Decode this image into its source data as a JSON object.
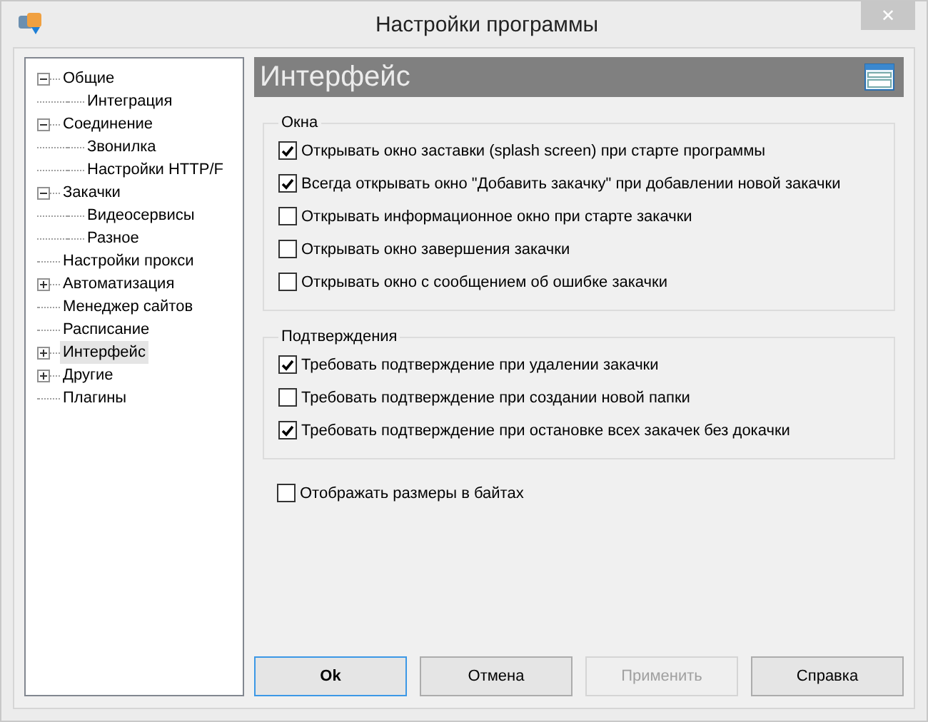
{
  "window": {
    "title": "Настройки программы",
    "close": "✕"
  },
  "tree": [
    {
      "label": "Общие",
      "expanded": true,
      "selected": false,
      "children": [
        {
          "label": "Интеграция",
          "selected": false
        }
      ]
    },
    {
      "label": "Соединение",
      "expanded": true,
      "selected": false,
      "children": [
        {
          "label": "Звонилка",
          "selected": false
        },
        {
          "label": "Настройки HTTP/F",
          "selected": false
        }
      ]
    },
    {
      "label": "Закачки",
      "expanded": true,
      "selected": false,
      "children": [
        {
          "label": "Видеосервисы",
          "selected": false
        },
        {
          "label": "Разное",
          "selected": false
        }
      ]
    },
    {
      "label": "Настройки прокси",
      "selected": false
    },
    {
      "label": "Автоматизация",
      "expanded": false,
      "selected": false
    },
    {
      "label": "Менеджер сайтов",
      "selected": false
    },
    {
      "label": "Расписание",
      "selected": false
    },
    {
      "label": "Интерфейс",
      "expanded": false,
      "selected": true
    },
    {
      "label": "Другие",
      "expanded": false,
      "selected": false
    },
    {
      "label": "Плагины",
      "selected": false
    }
  ],
  "header": {
    "title": "Интерфейс"
  },
  "groups": [
    {
      "title": "Окна",
      "options": [
        {
          "label": "Открывать окно заставки (splash screen) при старте программы",
          "checked": true
        },
        {
          "label": "Всегда открывать окно \"Добавить закачку\" при добавлении новой закачки",
          "checked": true
        },
        {
          "label": "Открывать информационное окно при старте закачки",
          "checked": false
        },
        {
          "label": "Открывать окно завершения закачки",
          "checked": false
        },
        {
          "label": "Открывать окно с сообщением об ошибке закачки",
          "checked": false
        }
      ]
    },
    {
      "title": "Подтверждения",
      "options": [
        {
          "label": "Требовать подтверждение при удалении закачки",
          "checked": true
        },
        {
          "label": "Требовать подтверждение при создании новой папки",
          "checked": false
        },
        {
          "label": "Требовать подтверждение при остановке всех закачек без докачки",
          "checked": true
        }
      ]
    }
  ],
  "extra_options": [
    {
      "label": "Отображать размеры в байтах",
      "checked": false
    }
  ],
  "buttons": [
    {
      "label": "Ok",
      "focused": true,
      "disabled": false
    },
    {
      "label": "Отмена",
      "focused": false,
      "disabled": false
    },
    {
      "label": "Применить",
      "focused": false,
      "disabled": true
    },
    {
      "label": "Справка",
      "focused": false,
      "disabled": false
    }
  ]
}
